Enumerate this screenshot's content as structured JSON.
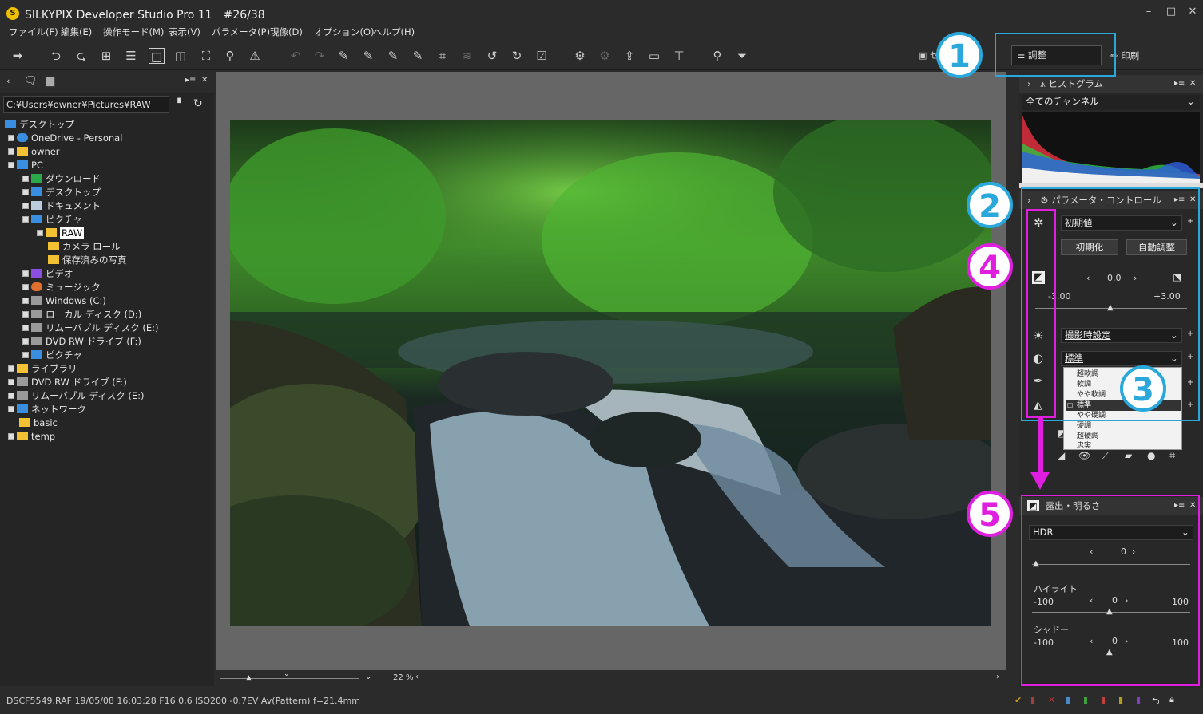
{
  "window": {
    "logo": "S",
    "title": "SILKYPIX Developer Studio Pro 11　#26/38",
    "minimize": "–",
    "maximize": "□",
    "close": "✕"
  },
  "menu": [
    "ファイル(F)",
    "編集(E)",
    "操作モード(M)",
    "表示(V)",
    "パラメータ(P)",
    "現像(D)",
    "オプション(O)",
    "ヘルプ(H)"
  ],
  "toolbar": {
    "adjust_label": "調整",
    "print_label": "印刷",
    "partial_label": "セ"
  },
  "left_panel": {
    "path": "C:¥Users¥owner¥Pictures¥RAW",
    "tree": [
      "デスクトップ",
      "OneDrive - Personal",
      "owner",
      "PC",
      "ダウンロード",
      "デスクトップ",
      "ドキュメント",
      "ピクチャ",
      "RAW",
      "カメラ ロール",
      "保存済みの写真",
      "ビデオ",
      "ミュージック",
      "Windows (C:)",
      "ローカル ディスク (D:)",
      "リムーバブル ディスク (E:)",
      "DVD RW ドライブ (F:)",
      "ピクチャ",
      "ライブラリ",
      "DVD RW ドライブ (F:)",
      "リムーバブル ディスク (E:)",
      "ネットワーク",
      "basic",
      "temp"
    ]
  },
  "zoom": {
    "value": "22",
    "unit": "%"
  },
  "status": "DSCF5549.RAF 19/05/08 16:03:28 F16 0,6 ISO200 -0.7EV Av(Pattern) f=21.4mm",
  "histogram": {
    "title": "ヒストグラム",
    "channel": "全てのチャンネル"
  },
  "param_control": {
    "title": "パラメータ・コントロール",
    "preset": "初期値",
    "init_button": "初期化",
    "auto_button": "自動調整",
    "exposure_value": "0.0",
    "exposure_min": "-3.00",
    "exposure_max": "+3.00",
    "wb": "撮影時設定",
    "tone": "標準",
    "tone_options": [
      "超軟調",
      "軟調",
      "やや軟調",
      "標準",
      "やや硬調",
      "硬調",
      "超硬調",
      "忠実"
    ],
    "tone_selected_index": 3
  },
  "exposure_panel": {
    "title": "露出・明るさ",
    "mode": "HDR",
    "hdr_value": "0",
    "highlight_label": "ハイライト",
    "highlight_value": "0",
    "highlight_min": "-100",
    "highlight_max": "100",
    "shadow_label": "シャドー",
    "shadow_value": "0",
    "shadow_min": "-100",
    "shadow_max": "100"
  },
  "callouts": [
    "1",
    "2",
    "3",
    "4",
    "5"
  ],
  "colors": {
    "callout_blue": "#2aa8dc",
    "callout_magenta": "#e01ee0",
    "folder": "#f3c232"
  }
}
